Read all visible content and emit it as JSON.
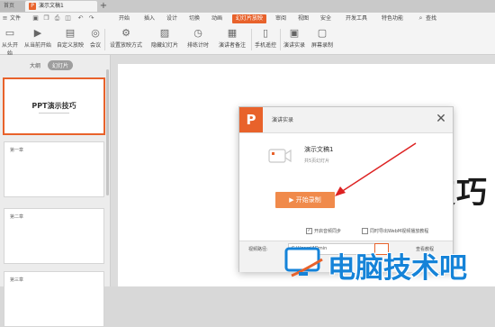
{
  "titlebar": {
    "home_tab": "首页",
    "doc_badge": "P",
    "doc_tab": "演示文稿1",
    "add_tab": "+"
  },
  "menu": {
    "file": "文件",
    "items": [
      "开始",
      "插入",
      "设计",
      "切换",
      "动画",
      "幻灯片放映",
      "审阅",
      "视图",
      "安全",
      "开发工具",
      "特色功能"
    ],
    "active": "幻灯片放映",
    "search": "查找"
  },
  "ribbon": {
    "buttons": [
      "从头开始",
      "从当前开始",
      "自定义放映",
      "会议",
      "设置放映方式",
      "隐藏幻灯片",
      "排练计时",
      "演讲者备注",
      "手机遥控",
      "演讲实录",
      "屏幕录制"
    ]
  },
  "left_panel": {
    "view_tabs": [
      "大纲",
      "幻灯片"
    ],
    "active_view": "幻灯片",
    "slides": [
      {
        "title": "PPT演示技巧",
        "label": ""
      },
      {
        "title": "",
        "label": "第一章"
      },
      {
        "title": "",
        "label": "第二章"
      },
      {
        "title": "",
        "label": "第三章"
      }
    ]
  },
  "canvas": {
    "title_fragment": "技巧"
  },
  "dialog": {
    "logo": "P",
    "title": "演讲实录",
    "close": "✕",
    "doc_name": "演示文稿1",
    "doc_count": "共5页幻灯片",
    "start_button": "开始录制",
    "checkbox_sync": "开启音频同步",
    "checkbox_webm": "同时导出WebM视频播放教程",
    "path_label": "视频路径:",
    "path_value": "C:\\Users\\ADmin",
    "help_link": "查看教程"
  },
  "watermark": {
    "text": "电脑技术吧"
  },
  "colors": {
    "accent": "#e8622b",
    "button": "#f08a4b",
    "watermark": "#1583d8"
  }
}
